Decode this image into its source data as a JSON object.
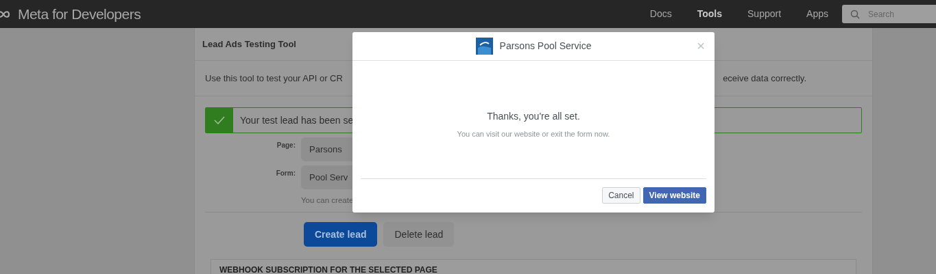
{
  "header": {
    "logo": "Meta for Developers",
    "nav": [
      {
        "label": "Docs",
        "selected": false
      },
      {
        "label": "Tools",
        "selected": true
      },
      {
        "label": "Support",
        "selected": false
      },
      {
        "label": "Apps",
        "selected": false
      }
    ],
    "search": {
      "placeholder": "Search"
    }
  },
  "panel": {
    "title": "Lead Ads Testing Tool",
    "description_start": "Use this tool to test your API or CR",
    "description_end": "eceive data correctly.",
    "banner": "Your test lead has been se",
    "fields": [
      {
        "label": "Page:",
        "value": "Parsons"
      },
      {
        "label": "Form:",
        "value": "Pool Serv"
      }
    ],
    "hint": "You can create",
    "buttons": [
      {
        "label": "Create lead",
        "kind": "primary"
      },
      {
        "label": "Delete lead",
        "kind": "secondary"
      }
    ],
    "webhook_title": "WEBHOOK SUBSCRIPTION FOR THE SELECTED PAGE"
  },
  "dialog": {
    "title": "Parsons Pool Service",
    "close": "×",
    "message": "Thanks, you're all set.",
    "submessage": "You can visit our website or exit the form now.",
    "buttons": [
      {
        "label": "Cancel",
        "kind": "secondary"
      },
      {
        "label": "View website",
        "kind": "primary"
      }
    ]
  }
}
